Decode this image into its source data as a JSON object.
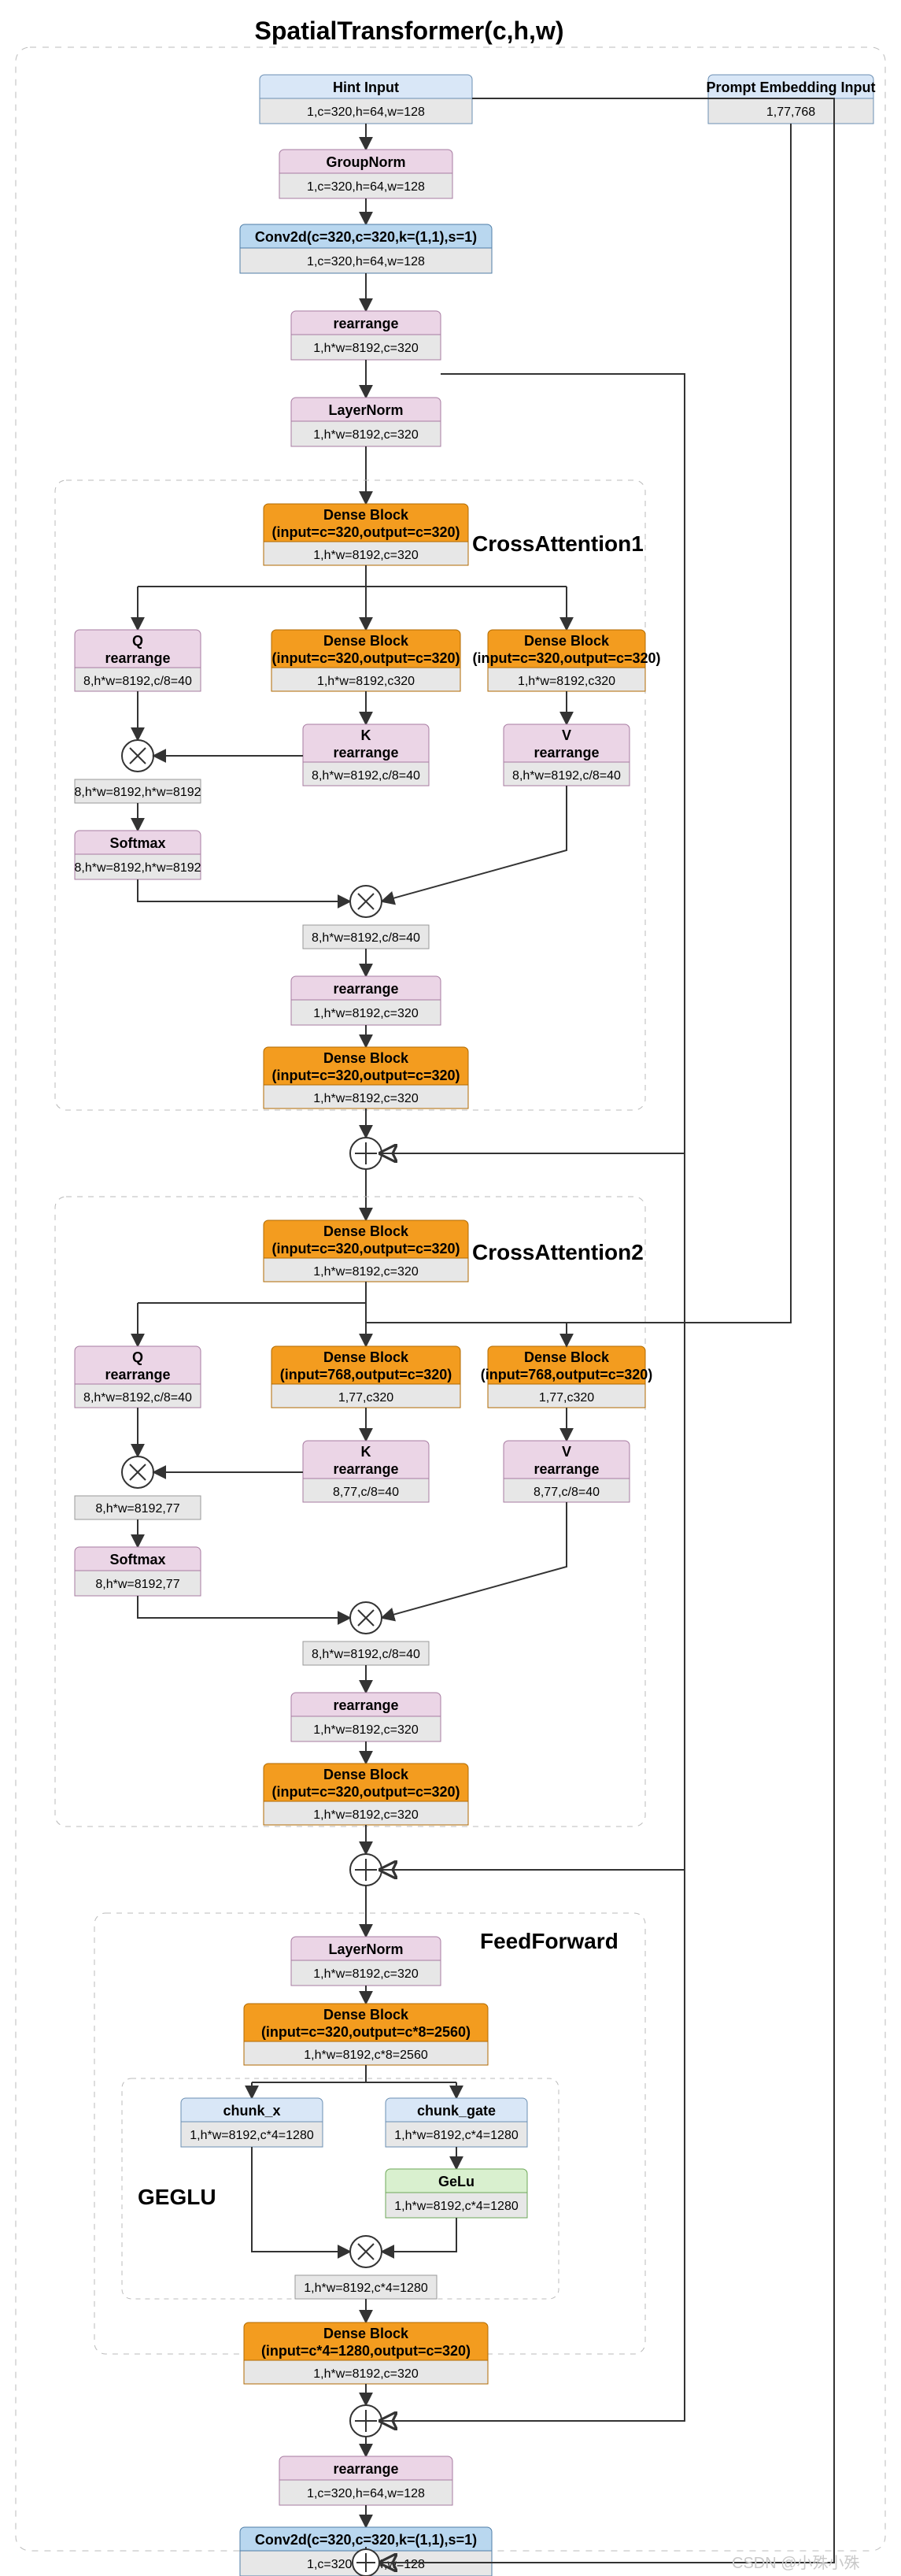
{
  "title": "SpatialTransformer(c,h,w)",
  "watermark": "CSDN @小殊小殊",
  "groups": {
    "ca1": "CrossAttention1",
    "ca2": "CrossAttention2",
    "ff": "FeedForward",
    "geglu": "GEGLU"
  },
  "nodes": {
    "hint": {
      "h": "Hint Input",
      "s": "1,c=320,h=64,w=128"
    },
    "prompt": {
      "h": "Prompt Embedding Input",
      "s": "1,77,768"
    },
    "gn": {
      "h": "GroupNorm",
      "s": "1,c=320,h=64,w=128"
    },
    "conv1": {
      "h": "Conv2d(c=320,c=320,k=(1,1),s=1)",
      "s": "1,c=320,h=64,w=128"
    },
    "re1": {
      "h": "rearrange",
      "s": "1,h*w=8192,c=320"
    },
    "ln1": {
      "h": "LayerNorm",
      "s": "1,h*w=8192,c=320"
    },
    "db1": {
      "h": "Dense Block",
      "h2": "(input=c=320,output=c=320)",
      "s": "1,h*w=8192,c=320"
    },
    "dbQ1": {
      "h": "Dense Block",
      "h2": "(input=c=320,output=c=320)",
      "s": "1,h*w=8192,c320"
    },
    "dbK1": {
      "h": "Dense Block",
      "h2": "(input=c=320,output=c=320)",
      "s": "1,h*w=8192,c320"
    },
    "dbV1": {
      "h": "Dense Block",
      "h2": "(input=c=320,output=c=320)",
      "s": "1,h*w=8192,c320"
    },
    "qRe1": {
      "h": "Q",
      "h2": "rearrange",
      "s": "8,h*w=8192,c/8=40"
    },
    "kRe1": {
      "h": "K",
      "h2": "rearrange",
      "s": "8,h*w=8192,c/8=40"
    },
    "vRe1": {
      "h": "V",
      "h2": "rearrange",
      "s": "8,h*w=8192,c/8=40"
    },
    "mm1a_s": "8,h*w=8192,h*w=8192",
    "sm1": {
      "h": "Softmax",
      "s": "8,h*w=8192,h*w=8192"
    },
    "mm1b_s": "8,h*w=8192,c/8=40",
    "re_out1": {
      "h": "rearrange",
      "s": "1,h*w=8192,c=320"
    },
    "db_out1": {
      "h": "Dense Block",
      "h2": "(input=c=320,output=c=320)",
      "s": "1,h*w=8192,c=320"
    },
    "db2": {
      "h": "Dense Block",
      "h2": "(input=c=320,output=c=320)",
      "s": "1,h*w=8192,c=320"
    },
    "dbQ2": {
      "h": "Dense Block",
      "h2": "(input=c=320,output=c=320)",
      "s": "1,h*w=8192,c320"
    },
    "dbK2": {
      "h": "Dense Block",
      "h2": "(input=768,output=c=320)",
      "s": "1,77,c320"
    },
    "dbV2": {
      "h": "Dense Block",
      "h2": "(input=768,output=c=320)",
      "s": "1,77,c320"
    },
    "qRe2": {
      "h": "Q",
      "h2": "rearrange",
      "s": "8,h*w=8192,c/8=40"
    },
    "kRe2": {
      "h": "K",
      "h2": "rearrange",
      "s": "8,77,c/8=40"
    },
    "vRe2": {
      "h": "V",
      "h2": "rearrange",
      "s": "8,77,c/8=40"
    },
    "mm2a_s": "8,h*w=8192,77",
    "sm2": {
      "h": "Softmax",
      "s": "8,h*w=8192,77"
    },
    "mm2b_s": "8,h*w=8192,c/8=40",
    "re_out2": {
      "h": "rearrange",
      "s": "1,h*w=8192,c=320"
    },
    "db_out2": {
      "h": "Dense Block",
      "h2": "(input=c=320,output=c=320)",
      "s": "1,h*w=8192,c=320"
    },
    "ln2": {
      "h": "LayerNorm",
      "s": "1,h*w=8192,c=320"
    },
    "db_ff1": {
      "h": "Dense Block",
      "h2": "(input=c=320,output=c*8=2560)",
      "s": "1,h*w=8192,c*8=2560"
    },
    "chunk_x": {
      "h": "chunk_x",
      "s": "1,h*w=8192,c*4=1280"
    },
    "chunk_g": {
      "h": "chunk_gate",
      "s": "1,h*w=8192,c*4=1280"
    },
    "gelu": {
      "h": "GeLu",
      "s": "1,h*w=8192,c*4=1280"
    },
    "mm_ff_s": "1,h*w=8192,c*4=1280",
    "db_ff2": {
      "h": "Dense Block",
      "h2": "(input=c*4=1280,output=c=320)",
      "s": "1,h*w=8192,c=320"
    },
    "re_end": {
      "h": "rearrange",
      "s": "1,c=320,h=64,w=128"
    },
    "conv2": {
      "h": "Conv2d(c=320,c=320,k=(1,1),s=1)",
      "s": "1,c=320,h=64,w=128"
    }
  }
}
